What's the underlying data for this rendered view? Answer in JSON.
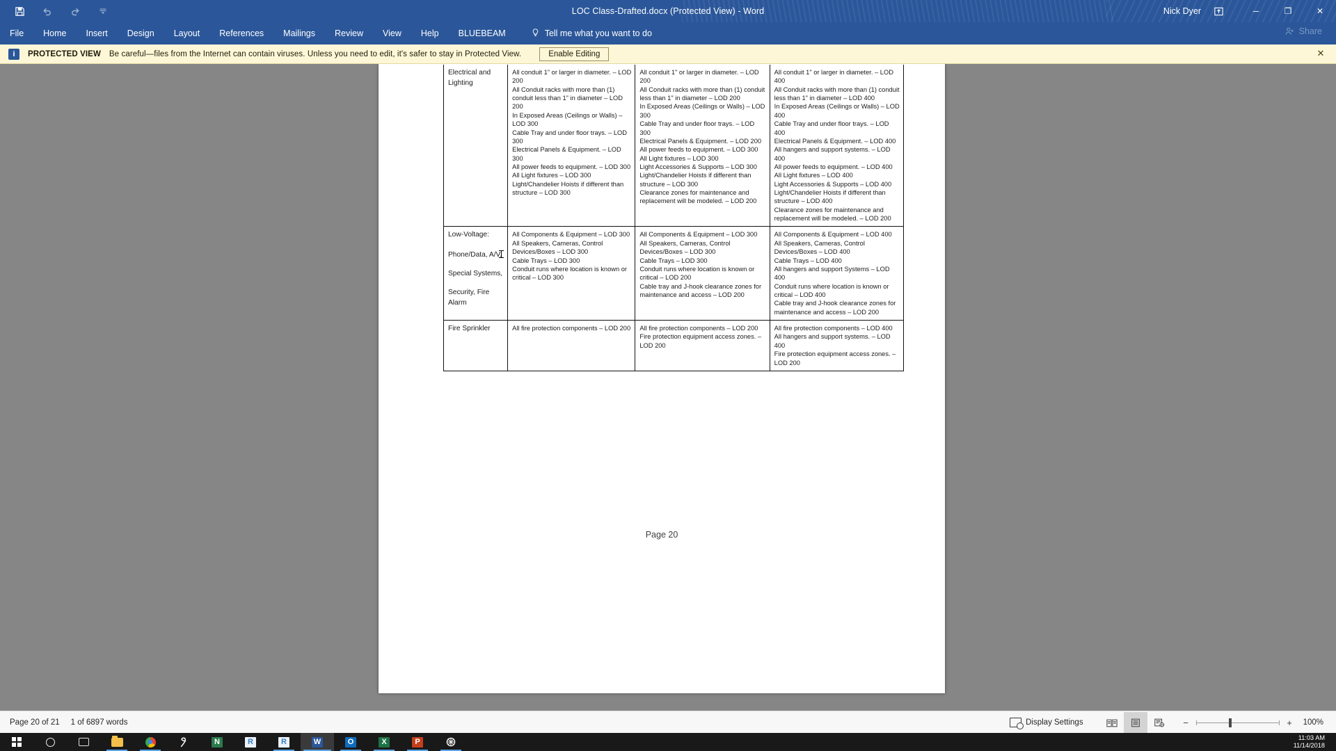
{
  "titlebar": {
    "quick_access": [
      {
        "name": "save-icon",
        "glyph": "💾"
      },
      {
        "name": "undo-icon",
        "glyph": "↶"
      },
      {
        "name": "redo-icon",
        "glyph": "↻"
      },
      {
        "name": "customize-quick-access-icon",
        "glyph": "⯆"
      }
    ],
    "document_title": "LOC Class-Drafted.docx (Protected View)  -  Word",
    "user_name": "Nick Dyer",
    "ribbon_display_options_icon": "⤒",
    "minimize": "─",
    "restore": "❐",
    "close": "✕"
  },
  "ribbon": {
    "tabs": [
      "File",
      "Home",
      "Insert",
      "Design",
      "Layout",
      "References",
      "Mailings",
      "Review",
      "View",
      "Help",
      "BLUEBEAM"
    ],
    "tell_me": "Tell me what you want to do",
    "tell_me_icon": "lightbulb-icon",
    "share_label": "Share"
  },
  "protected_view": {
    "info_glyph": "i",
    "label": "PROTECTED VIEW",
    "message": "Be careful—files from the Internet can contain viruses. Unless you need to edit, it's safer to stay in Protected View.",
    "enable_button": "Enable Editing",
    "close_glyph": "✕"
  },
  "document": {
    "page_footer": "Page 20",
    "table": {
      "rows": [
        {
          "label_lines": [
            "Electrical and Lighting"
          ],
          "cells": [
            [
              "All conduit 1\" or larger in diameter. – LOD 200",
              "All Conduit racks with more than (1) conduit less than 1\" in diameter – LOD 200",
              "In Exposed Areas (Ceilings or Walls) – LOD 300",
              "Cable Tray and under floor trays. – LOD 300",
              "Electrical Panels & Equipment. – LOD 300",
              "All power feeds to equipment. – LOD 300",
              "All Light fixtures – LOD 300",
              "Light/Chandelier Hoists if different than structure – LOD 300"
            ],
            [
              "All conduit 1\" or larger in diameter. – LOD 200",
              "All Conduit racks with more than (1) conduit less than 1\" in diameter – LOD 200",
              "In Exposed Areas (Ceilings or Walls) – LOD 300",
              "Cable Tray and under floor trays. – LOD 300",
              "Electrical Panels & Equipment. – LOD 200",
              "All power feeds to equipment. – LOD 300",
              "All Light fixtures – LOD 300",
              "Light Accessories & Supports – LOD 300",
              "Light/Chandelier Hoists if different than structure – LOD 300",
              "Clearance zones for maintenance and replacement will be modeled. – LOD 200"
            ],
            [
              "All conduit 1\" or larger in diameter. – LOD 400",
              "All Conduit racks with more than (1) conduit less than 1\" in diameter – LOD 400",
              "In Exposed Areas (Ceilings or Walls) – LOD 400",
              "Cable Tray and under floor trays. – LOD 400",
              "Electrical Panels & Equipment. – LOD 400",
              "All hangers and support systems. – LOD 400",
              "All power feeds to equipment. – LOD 400",
              "All Light fixtures – LOD 400",
              "Light Accessories & Supports – LOD 400",
              "Light/Chandelier Hoists if different than structure – LOD 400",
              "Clearance zones for maintenance and replacement will be modeled. – LOD 200"
            ]
          ]
        },
        {
          "label_lines": [
            "Low-Voltage:",
            "Phone/Data, A/V,",
            "Special Systems,",
            "Security, Fire Alarm"
          ],
          "cells": [
            [
              "All Components & Equipment – LOD 300",
              "All Speakers, Cameras, Control Devices/Boxes – LOD 300",
              "Cable Trays – LOD 300",
              "Conduit runs where location is known or critical – LOD 300"
            ],
            [
              "All Components & Equipment – LOD 300",
              "All Speakers, Cameras, Control Devices/Boxes – LOD 300",
              "Cable Trays – LOD 300",
              "Conduit runs where location is known or critical – LOD 200",
              "Cable tray and J-hook clearance zones for maintenance and access – LOD 200"
            ],
            [
              "All Components & Equipment – LOD 400",
              "All Speakers, Cameras, Control Devices/Boxes – LOD 400",
              "Cable Trays – LOD 400",
              "All hangers and support Systems – LOD 400",
              "Conduit runs where location is known or critical – LOD 400",
              "Cable tray and J-hook clearance zones for maintenance and access – LOD 200"
            ]
          ]
        },
        {
          "label_lines": [
            "Fire Sprinkler"
          ],
          "cells": [
            [
              "All fire protection components – LOD 200"
            ],
            [
              "All fire protection components – LOD 200",
              "Fire protection equipment access zones. – LOD 200"
            ],
            [
              "All fire protection components – LOD 400",
              "All hangers and support systems. – LOD 400",
              "Fire protection equipment access zones. – LOD 200"
            ]
          ]
        }
      ]
    }
  },
  "statusbar": {
    "page_status": "Page 20 of 21",
    "word_count": "1 of 6897 words",
    "display_settings": "Display Settings",
    "views": [
      "read-mode-icon",
      "print-layout-icon",
      "web-layout-icon"
    ],
    "active_view_index": 1,
    "zoom_out": "−",
    "zoom_in": "+",
    "zoom_level": "100%"
  },
  "taskbar": {
    "items": [
      {
        "name": "start-button-icon",
        "kind": "winlogo",
        "label": ""
      },
      {
        "name": "cortana-search-icon",
        "kind": "circle",
        "label": ""
      },
      {
        "name": "task-view-icon",
        "kind": "taskview",
        "label": ""
      },
      {
        "name": "file-explorer-icon",
        "kind": "folder",
        "label": "",
        "running": true
      },
      {
        "name": "google-chrome-icon",
        "kind": "chrome",
        "label": "",
        "running": true
      },
      {
        "name": "revu-bluebeam-icon",
        "kind": "glyph",
        "label": "R",
        "color": "#ffffff",
        "bg": "transparent"
      },
      {
        "name": "onenote-icon",
        "kind": "tile",
        "label": "N",
        "color": "#ffffff",
        "bg": "#2b7a4b"
      },
      {
        "name": "revit-icon",
        "kind": "tile",
        "label": "R",
        "color": "#3b7dc4",
        "bg": "#eaf2fb"
      },
      {
        "name": "revit-second-icon",
        "kind": "tile",
        "label": "R",
        "color": "#3b7dc4",
        "bg": "#eaf2fb",
        "running": true
      },
      {
        "name": "word-icon",
        "kind": "tile",
        "label": "W",
        "color": "#ffffff",
        "bg": "#2b579a",
        "active": true
      },
      {
        "name": "outlook-icon",
        "kind": "tile",
        "label": "O",
        "color": "#ffffff",
        "bg": "#0f6cbd",
        "running": true
      },
      {
        "name": "excel-icon",
        "kind": "tile",
        "label": "X",
        "color": "#ffffff",
        "bg": "#1d7044",
        "running": true
      },
      {
        "name": "powerpoint-icon",
        "kind": "tile",
        "label": "P",
        "color": "#ffffff",
        "bg": "#c43e1c",
        "running": true
      },
      {
        "name": "navisworks-icon",
        "kind": "gear",
        "label": "",
        "running": true
      }
    ],
    "time": "11:03 AM",
    "date": "11/14/2018"
  },
  "colors": {
    "word_blue": "#2b579a",
    "protected_yellow": "#fdf7d8",
    "canvas_gray": "#868686",
    "taskbar": "#191919",
    "accent_blue": "#5aa5e8"
  }
}
